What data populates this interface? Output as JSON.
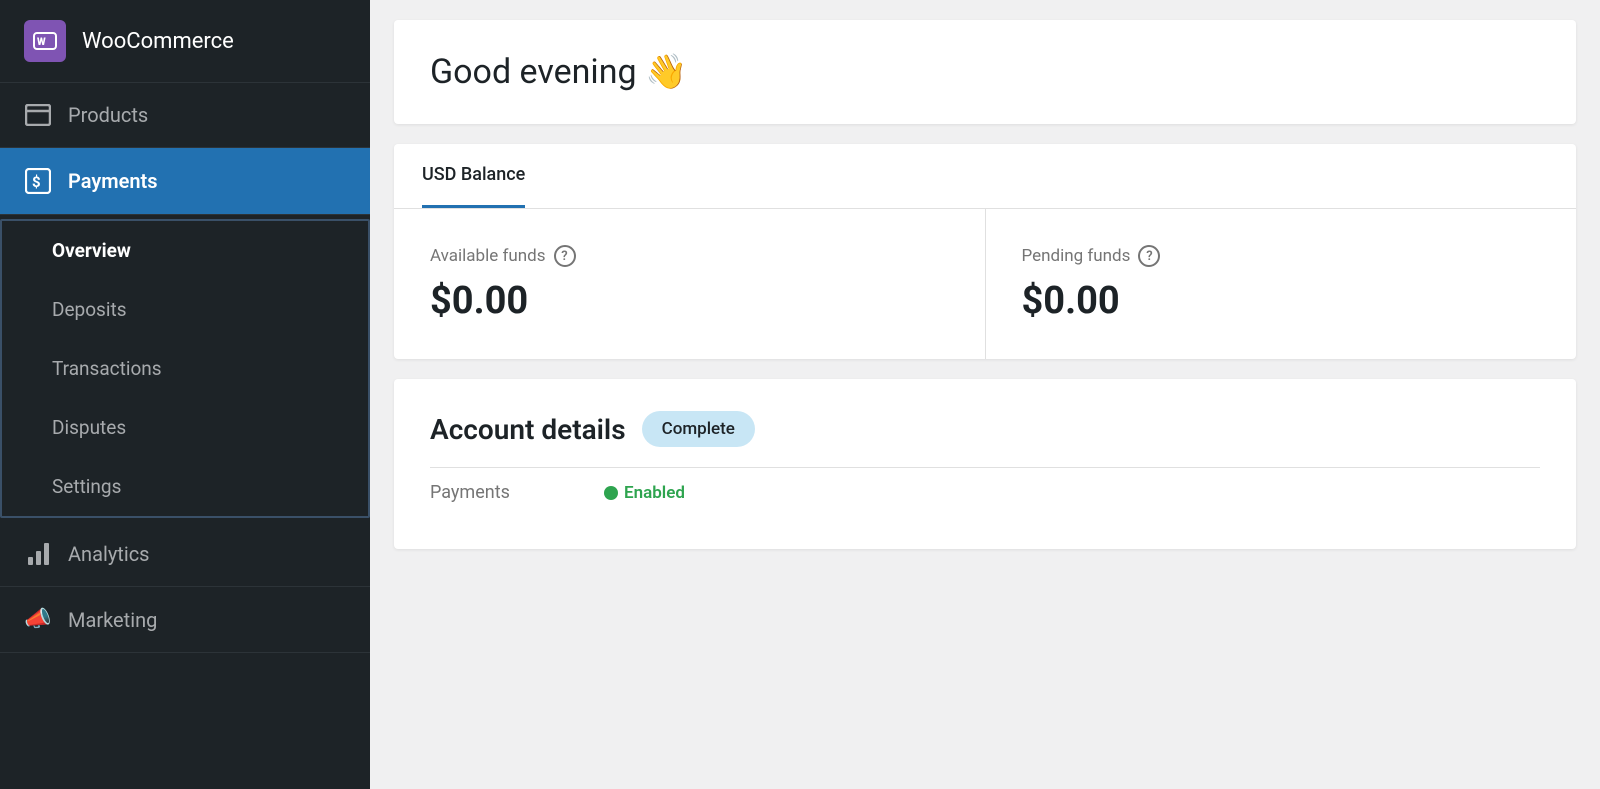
{
  "sidebar": {
    "logo": {
      "icon_text": "woo",
      "label": "WooCommerce"
    },
    "items": [
      {
        "id": "products",
        "label": "Products",
        "icon_type": "products"
      },
      {
        "id": "payments",
        "label": "Payments",
        "icon_type": "payments",
        "active": true
      },
      {
        "id": "analytics",
        "label": "Analytics",
        "icon_type": "analytics"
      },
      {
        "id": "marketing",
        "label": "Marketing",
        "icon_type": "megaphone"
      }
    ],
    "submenu": {
      "parent_id": "payments",
      "items": [
        {
          "id": "overview",
          "label": "Overview",
          "active": true
        },
        {
          "id": "deposits",
          "label": "Deposits",
          "active": false
        },
        {
          "id": "transactions",
          "label": "Transactions",
          "active": false
        },
        {
          "id": "disputes",
          "label": "Disputes",
          "active": false
        },
        {
          "id": "settings",
          "label": "Settings",
          "active": false
        }
      ]
    }
  },
  "main": {
    "greeting": {
      "text": "Good evening",
      "emoji": "👋"
    },
    "balance": {
      "tab_label": "USD Balance",
      "available_funds": {
        "label": "Available funds",
        "amount": "$0.00",
        "help": "?"
      },
      "pending_funds": {
        "label": "Pending funds",
        "amount": "$0.00",
        "help": "?"
      }
    },
    "account_details": {
      "title": "Account details",
      "badge": "Complete",
      "row_label": "Payments",
      "row_status": "Enabled"
    }
  }
}
